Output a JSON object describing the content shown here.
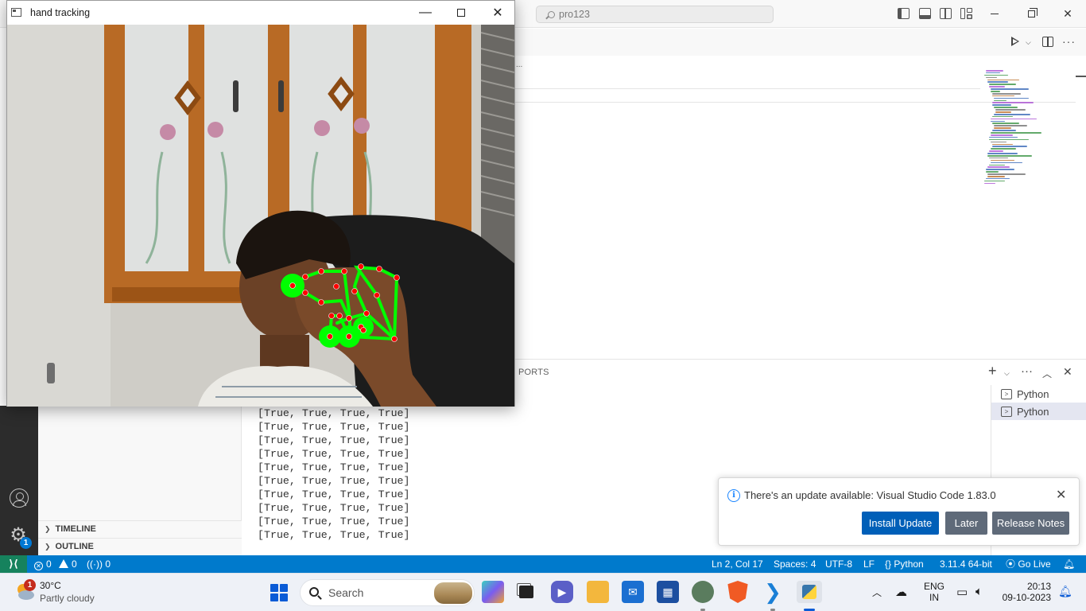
{
  "vscode": {
    "search_text": "pro123",
    "panel_tab": "PORTS",
    "terminal_tabs": [
      "Python",
      "Python"
    ],
    "terminal_lines": [
      "[True, True, True, True]",
      "[True, True, True, True]",
      "[True, True, True, True]",
      "[True, True, True, True]",
      "[True, True, True, True]",
      "[True, True, True, True]",
      "[True, True, True, True]",
      "[True, True, True, True]",
      "[True, True, True, True]",
      "[True, True, True, True]"
    ],
    "sidebar_sections": [
      "TIMELINE",
      "OUTLINE"
    ],
    "settings_badge": "1",
    "breadcrumb_dots": "..."
  },
  "notification": {
    "message": "There's an update available: Visual Studio Code 1.83.0",
    "install_label": "Install Update",
    "later_label": "Later",
    "release_notes_label": "Release Notes"
  },
  "statusbar": {
    "errors": "0",
    "warnings": "0",
    "ports": "0",
    "position": "Ln 2, Col 17",
    "spaces": "Spaces: 4",
    "encoding": "UTF-8",
    "eol": "LF",
    "language": "Python",
    "interpreter": "3.11.4 64-bit",
    "go_live": "Go Live"
  },
  "camera_window": {
    "title": "hand tracking"
  },
  "taskbar": {
    "temperature": "30°C",
    "weather": "Partly cloudy",
    "weather_badge": "1",
    "search_placeholder": "Search",
    "lang_top": "ENG",
    "lang_bottom": "IN",
    "time": "20:13",
    "date": "09-10-2023"
  },
  "colors": {
    "statusbar_bg": "#007acc",
    "landmark_line": "#00ff00",
    "landmark_point": "#ff0000",
    "primary_button": "#005fb8"
  }
}
